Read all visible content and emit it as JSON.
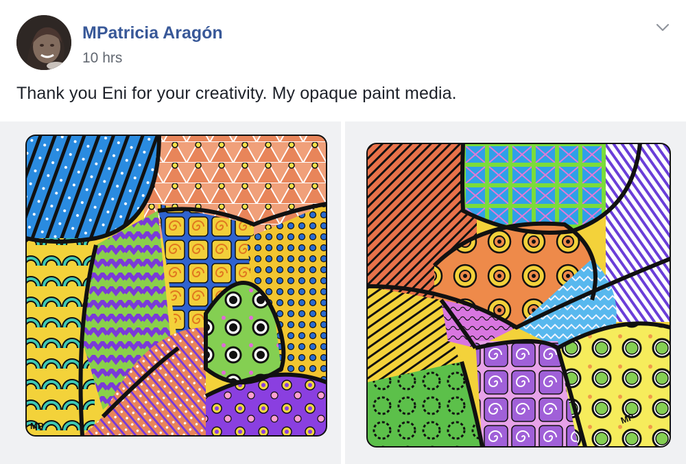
{
  "post": {
    "author_name": "MPatricia Aragón",
    "timestamp": "10 hrs",
    "text": "Thank you Eni for your creativity. My opaque paint media.",
    "menu_icon": "chevron-down-icon"
  },
  "photos": [
    {
      "signature": "MP"
    },
    {
      "signature": "MP"
    }
  ],
  "colors": {
    "author_link": "#385898",
    "timestamp": "#616770",
    "text": "#1d2129"
  }
}
